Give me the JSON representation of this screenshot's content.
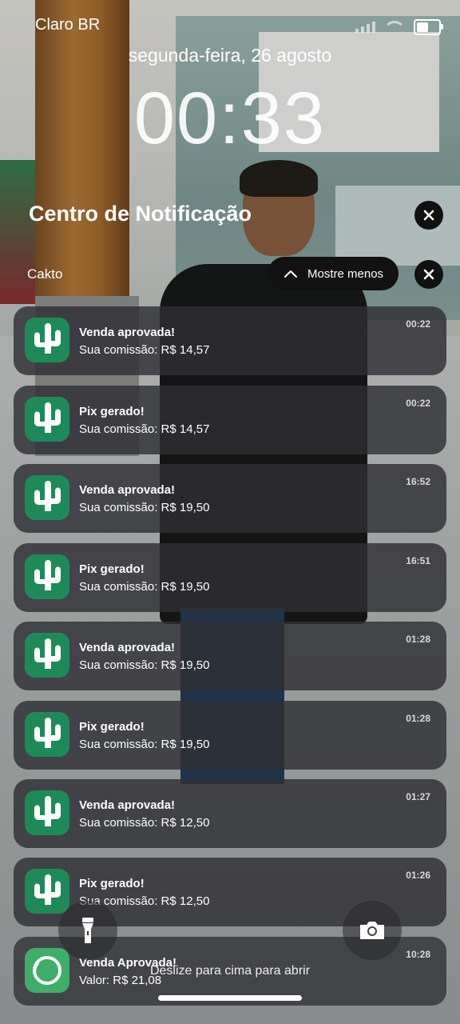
{
  "status_bar": {
    "carrier": "Claro BR",
    "battery_icon": "battery-icon",
    "wifi_icon": "wifi-icon",
    "signal_icon": "signal-icon"
  },
  "lock": {
    "date": "segunda-feira, 26 agosto",
    "time": "00:33"
  },
  "notification_center": {
    "title": "Centro de Notificação",
    "close_icon": "close-icon"
  },
  "group": {
    "app_name": "Cakto",
    "show_less_label": "Mostre menos",
    "chevron_icon": "chevron-up-icon"
  },
  "notifications": [
    {
      "app": "Cakto",
      "icon": "cactus-icon",
      "title": "Venda aprovada!",
      "body": "Sua comissão: R$ 14,57",
      "time": "00:22"
    },
    {
      "app": "Cakto",
      "icon": "cactus-icon",
      "title": "Pix gerado!",
      "body": "Sua comissão: R$ 14,57",
      "time": "00:22"
    },
    {
      "app": "Cakto",
      "icon": "cactus-icon",
      "title": "Venda aprovada!",
      "body": "Sua comissão: R$ 19,50",
      "time": "16:52"
    },
    {
      "app": "Cakto",
      "icon": "cactus-icon",
      "title": "Pix gerado!",
      "body": "Sua comissão: R$ 19,50",
      "time": "16:51"
    },
    {
      "app": "Cakto",
      "icon": "cactus-icon",
      "title": "Venda aprovada!",
      "body": "Sua comissão: R$ 19,50",
      "time": "01:28"
    },
    {
      "app": "Cakto",
      "icon": "cactus-icon",
      "title": "Pix gerado!",
      "body": "Sua comissão: R$ 19,50",
      "time": "01:28"
    },
    {
      "app": "Cakto",
      "icon": "cactus-icon",
      "title": "Venda aprovada!",
      "body": "Sua comissão: R$ 12,50",
      "time": "01:27"
    },
    {
      "app": "Cakto",
      "icon": "cactus-icon",
      "title": "Pix gerado!",
      "body": "Sua comissão: R$ 12,50",
      "time": "01:26"
    },
    {
      "app": "Kiwify",
      "icon": "kiwi-icon",
      "title": "Venda Aprovada!",
      "body": "Valor: R$ 21,08",
      "time": "10:28"
    }
  ],
  "bottom": {
    "flashlight_icon": "flashlight-icon",
    "camera_icon": "camera-icon",
    "swipe_hint": "Deslize para cima para abrir"
  },
  "colors": {
    "cakto_green": "#1e8a5a",
    "kiwify_green": "#3fae6a",
    "card_bg": "#303034"
  }
}
